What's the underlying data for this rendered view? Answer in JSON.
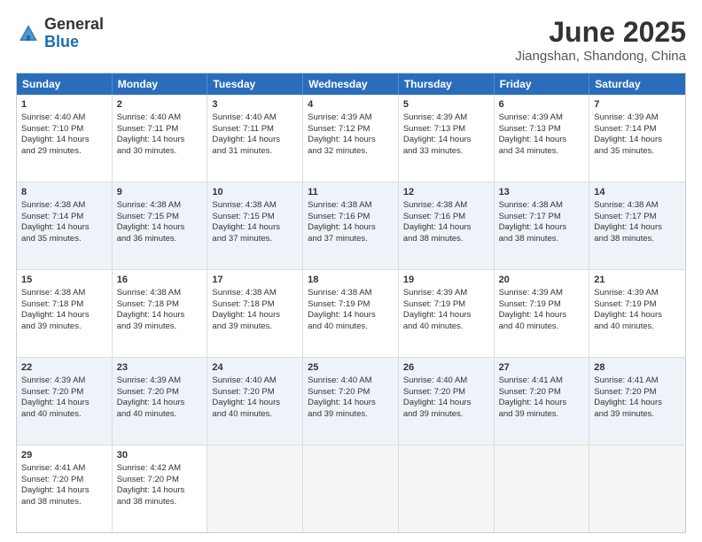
{
  "logo": {
    "general": "General",
    "blue": "Blue"
  },
  "title": {
    "month": "June 2025",
    "location": "Jiangshan, Shandong, China"
  },
  "header_days": [
    "Sunday",
    "Monday",
    "Tuesday",
    "Wednesday",
    "Thursday",
    "Friday",
    "Saturday"
  ],
  "rows": [
    [
      {
        "day": "1",
        "lines": [
          "Sunrise: 4:40 AM",
          "Sunset: 7:10 PM",
          "Daylight: 14 hours",
          "and 29 minutes."
        ]
      },
      {
        "day": "2",
        "lines": [
          "Sunrise: 4:40 AM",
          "Sunset: 7:11 PM",
          "Daylight: 14 hours",
          "and 30 minutes."
        ]
      },
      {
        "day": "3",
        "lines": [
          "Sunrise: 4:40 AM",
          "Sunset: 7:11 PM",
          "Daylight: 14 hours",
          "and 31 minutes."
        ]
      },
      {
        "day": "4",
        "lines": [
          "Sunrise: 4:39 AM",
          "Sunset: 7:12 PM",
          "Daylight: 14 hours",
          "and 32 minutes."
        ]
      },
      {
        "day": "5",
        "lines": [
          "Sunrise: 4:39 AM",
          "Sunset: 7:13 PM",
          "Daylight: 14 hours",
          "and 33 minutes."
        ]
      },
      {
        "day": "6",
        "lines": [
          "Sunrise: 4:39 AM",
          "Sunset: 7:13 PM",
          "Daylight: 14 hours",
          "and 34 minutes."
        ]
      },
      {
        "day": "7",
        "lines": [
          "Sunrise: 4:39 AM",
          "Sunset: 7:14 PM",
          "Daylight: 14 hours",
          "and 35 minutes."
        ]
      }
    ],
    [
      {
        "day": "8",
        "lines": [
          "Sunrise: 4:38 AM",
          "Sunset: 7:14 PM",
          "Daylight: 14 hours",
          "and 35 minutes."
        ]
      },
      {
        "day": "9",
        "lines": [
          "Sunrise: 4:38 AM",
          "Sunset: 7:15 PM",
          "Daylight: 14 hours",
          "and 36 minutes."
        ]
      },
      {
        "day": "10",
        "lines": [
          "Sunrise: 4:38 AM",
          "Sunset: 7:15 PM",
          "Daylight: 14 hours",
          "and 37 minutes."
        ]
      },
      {
        "day": "11",
        "lines": [
          "Sunrise: 4:38 AM",
          "Sunset: 7:16 PM",
          "Daylight: 14 hours",
          "and 37 minutes."
        ]
      },
      {
        "day": "12",
        "lines": [
          "Sunrise: 4:38 AM",
          "Sunset: 7:16 PM",
          "Daylight: 14 hours",
          "and 38 minutes."
        ]
      },
      {
        "day": "13",
        "lines": [
          "Sunrise: 4:38 AM",
          "Sunset: 7:17 PM",
          "Daylight: 14 hours",
          "and 38 minutes."
        ]
      },
      {
        "day": "14",
        "lines": [
          "Sunrise: 4:38 AM",
          "Sunset: 7:17 PM",
          "Daylight: 14 hours",
          "and 38 minutes."
        ]
      }
    ],
    [
      {
        "day": "15",
        "lines": [
          "Sunrise: 4:38 AM",
          "Sunset: 7:18 PM",
          "Daylight: 14 hours",
          "and 39 minutes."
        ]
      },
      {
        "day": "16",
        "lines": [
          "Sunrise: 4:38 AM",
          "Sunset: 7:18 PM",
          "Daylight: 14 hours",
          "and 39 minutes."
        ]
      },
      {
        "day": "17",
        "lines": [
          "Sunrise: 4:38 AM",
          "Sunset: 7:18 PM",
          "Daylight: 14 hours",
          "and 39 minutes."
        ]
      },
      {
        "day": "18",
        "lines": [
          "Sunrise: 4:38 AM",
          "Sunset: 7:19 PM",
          "Daylight: 14 hours",
          "and 40 minutes."
        ]
      },
      {
        "day": "19",
        "lines": [
          "Sunrise: 4:39 AM",
          "Sunset: 7:19 PM",
          "Daylight: 14 hours",
          "and 40 minutes."
        ]
      },
      {
        "day": "20",
        "lines": [
          "Sunrise: 4:39 AM",
          "Sunset: 7:19 PM",
          "Daylight: 14 hours",
          "and 40 minutes."
        ]
      },
      {
        "day": "21",
        "lines": [
          "Sunrise: 4:39 AM",
          "Sunset: 7:19 PM",
          "Daylight: 14 hours",
          "and 40 minutes."
        ]
      }
    ],
    [
      {
        "day": "22",
        "lines": [
          "Sunrise: 4:39 AM",
          "Sunset: 7:20 PM",
          "Daylight: 14 hours",
          "and 40 minutes."
        ]
      },
      {
        "day": "23",
        "lines": [
          "Sunrise: 4:39 AM",
          "Sunset: 7:20 PM",
          "Daylight: 14 hours",
          "and 40 minutes."
        ]
      },
      {
        "day": "24",
        "lines": [
          "Sunrise: 4:40 AM",
          "Sunset: 7:20 PM",
          "Daylight: 14 hours",
          "and 40 minutes."
        ]
      },
      {
        "day": "25",
        "lines": [
          "Sunrise: 4:40 AM",
          "Sunset: 7:20 PM",
          "Daylight: 14 hours",
          "and 39 minutes."
        ]
      },
      {
        "day": "26",
        "lines": [
          "Sunrise: 4:40 AM",
          "Sunset: 7:20 PM",
          "Daylight: 14 hours",
          "and 39 minutes."
        ]
      },
      {
        "day": "27",
        "lines": [
          "Sunrise: 4:41 AM",
          "Sunset: 7:20 PM",
          "Daylight: 14 hours",
          "and 39 minutes."
        ]
      },
      {
        "day": "28",
        "lines": [
          "Sunrise: 4:41 AM",
          "Sunset: 7:20 PM",
          "Daylight: 14 hours",
          "and 39 minutes."
        ]
      }
    ],
    [
      {
        "day": "29",
        "lines": [
          "Sunrise: 4:41 AM",
          "Sunset: 7:20 PM",
          "Daylight: 14 hours",
          "and 38 minutes."
        ]
      },
      {
        "day": "30",
        "lines": [
          "Sunrise: 4:42 AM",
          "Sunset: 7:20 PM",
          "Daylight: 14 hours",
          "and 38 minutes."
        ]
      },
      {
        "day": "",
        "lines": []
      },
      {
        "day": "",
        "lines": []
      },
      {
        "day": "",
        "lines": []
      },
      {
        "day": "",
        "lines": []
      },
      {
        "day": "",
        "lines": []
      }
    ]
  ]
}
